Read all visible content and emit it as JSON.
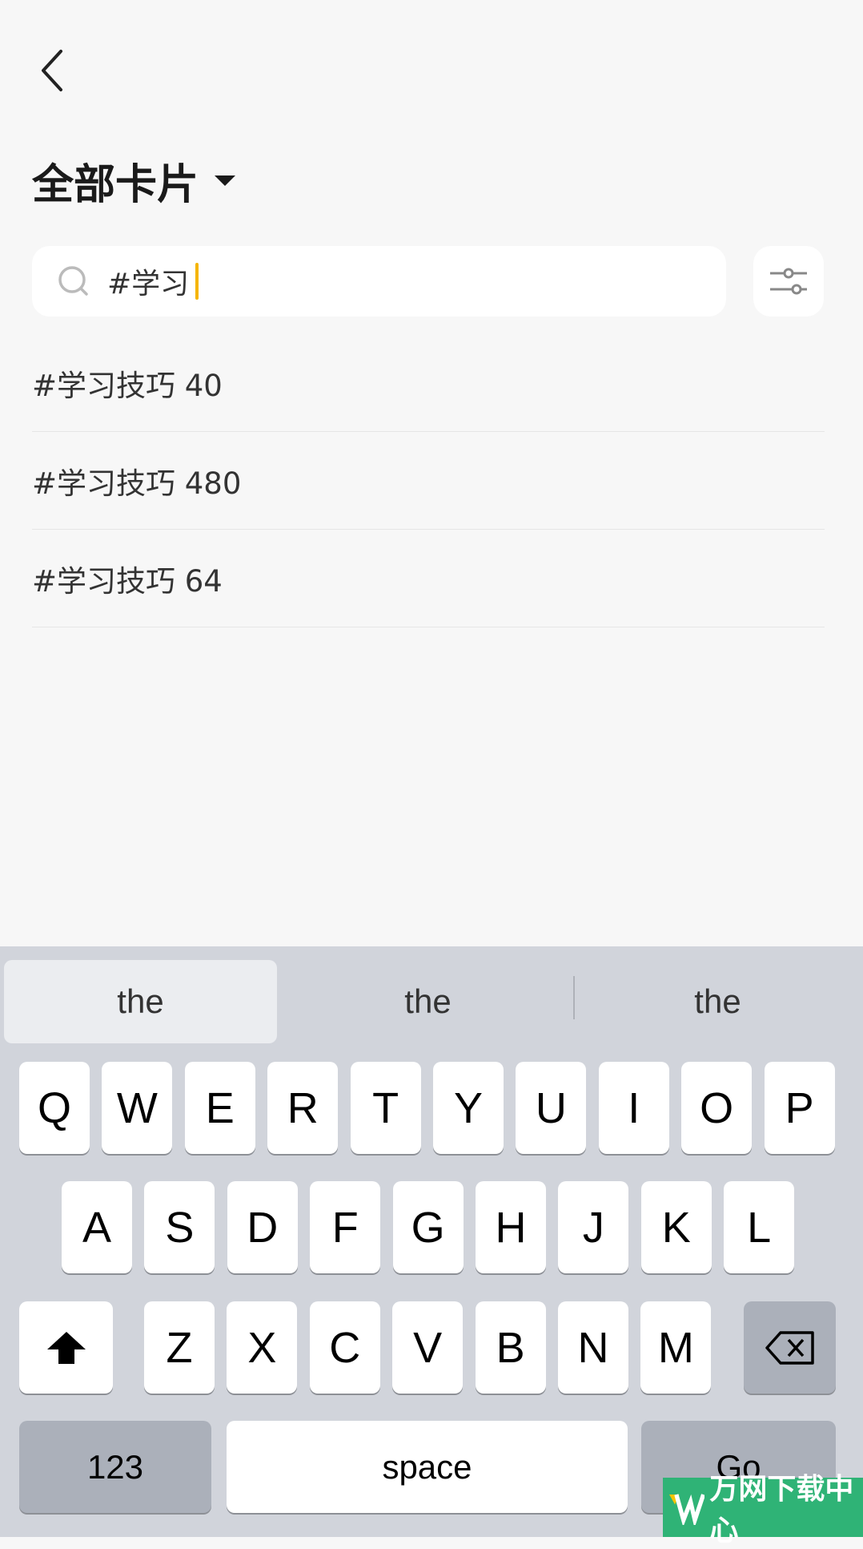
{
  "header": {
    "title": "全部卡片",
    "back_icon": "chevron-left-icon",
    "dropdown_icon": "caret-down-icon"
  },
  "search": {
    "value": "#学习",
    "cursor_color": "#f5b500",
    "filter_icon": "sliders-icon"
  },
  "results": [
    {
      "label": "#学习技巧 40"
    },
    {
      "label": "#学习技巧 480"
    },
    {
      "label": "#学习技巧 64"
    }
  ],
  "keyboard": {
    "suggestions": [
      "the",
      "the",
      "the"
    ],
    "row1": [
      "Q",
      "W",
      "E",
      "R",
      "T",
      "Y",
      "U",
      "I",
      "O",
      "P"
    ],
    "row2": [
      "A",
      "S",
      "D",
      "F",
      "G",
      "H",
      "J",
      "K",
      "L"
    ],
    "row3": [
      "Z",
      "X",
      "C",
      "V",
      "B",
      "N",
      "M"
    ],
    "numbers_label": "123",
    "space_label": "space",
    "go_label": "Go"
  },
  "watermark": {
    "text": "万网下载中心",
    "brand_color": "#2fb376"
  }
}
